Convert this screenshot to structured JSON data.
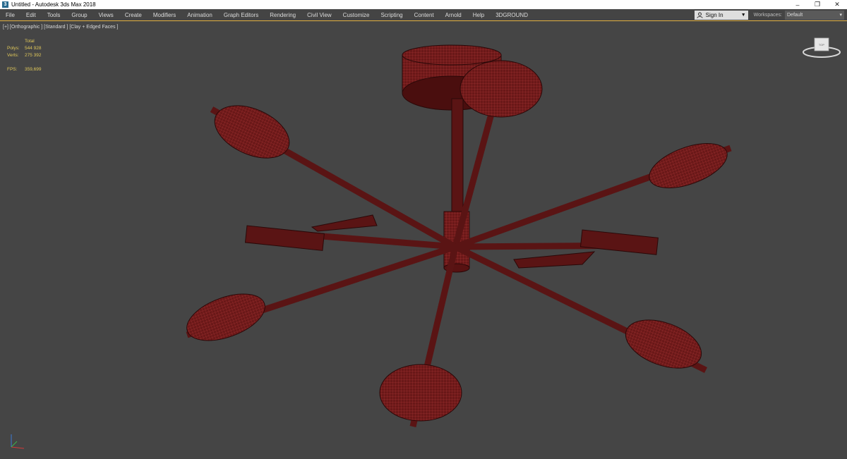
{
  "window": {
    "title": "Untitled - Autodesk 3ds Max 2018",
    "controls": [
      "–",
      "❐",
      "✕"
    ]
  },
  "menu": {
    "items": [
      "File",
      "Edit",
      "Tools",
      "Group",
      "Views",
      "Create",
      "Modifiers",
      "Animation",
      "Graph Editors",
      "Rendering",
      "Civil View",
      "Customize",
      "Scripting",
      "Content",
      "Arnold",
      "Help",
      "3DGROUND"
    ],
    "signin": "Sign In",
    "workspaces_label": "Workspaces:",
    "workspace_value": "Default"
  },
  "viewport": {
    "label": "[+] [Orthographic ] [Standard ] [Clay + Edged Faces ]",
    "stats": {
      "header": "Total",
      "polys_label": "Polys:",
      "polys_value": "544 928",
      "verts_label": "Verts:",
      "verts_value": "275 392",
      "fps_label": "FPS:",
      "fps_value": "359,699"
    },
    "viewcube_label": "TOP"
  },
  "colors": {
    "model_fill": "#5a1414",
    "model_wire": "#b03030",
    "stats_text": "#e0c85a",
    "viewport_bg": "#454545"
  }
}
